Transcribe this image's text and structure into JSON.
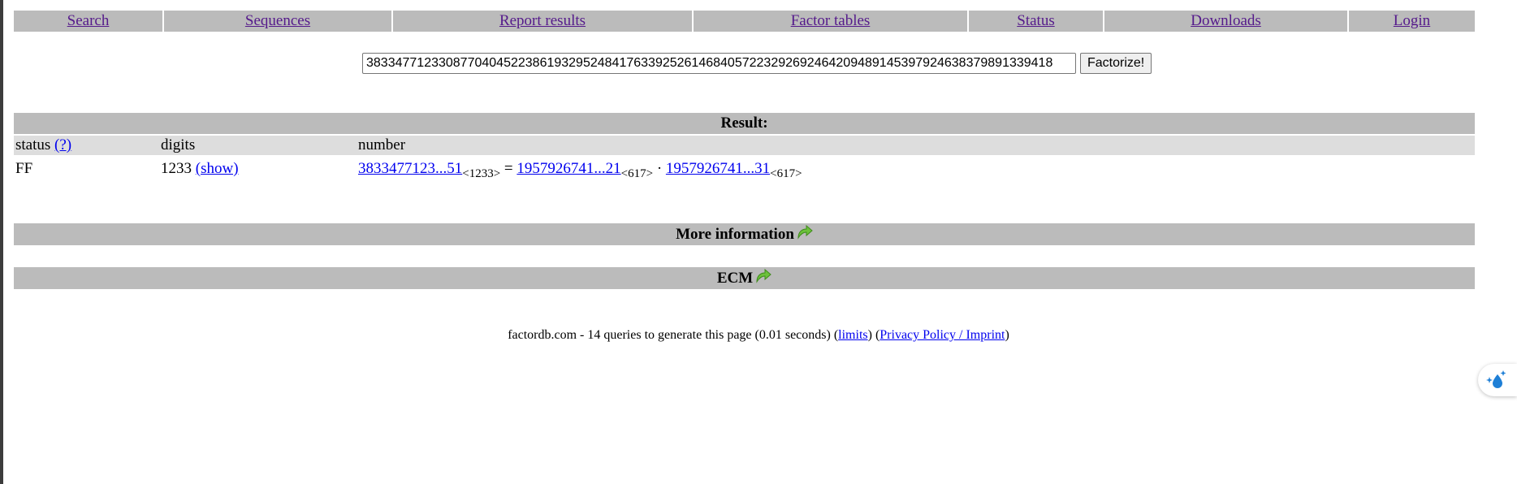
{
  "nav": {
    "items": [
      {
        "label": "Search"
      },
      {
        "label": "Sequences"
      },
      {
        "label": "Report results"
      },
      {
        "label": "Factor tables"
      },
      {
        "label": "Status"
      },
      {
        "label": "Downloads"
      },
      {
        "label": "Login"
      }
    ]
  },
  "search": {
    "value": "38334771233087704045223861932952484176339252614684057223292692464209489145397924638379891339418",
    "button_label": "Factorize!"
  },
  "result": {
    "title": "Result:",
    "headers": {
      "status": "status",
      "status_help": "(?)",
      "digits": "digits",
      "number": "number"
    },
    "row": {
      "status": "FF",
      "digits": "1233",
      "show_link": "(show)",
      "number_link": "3833477123...51",
      "number_digits": "<1233>",
      "equals": "=",
      "factor1_link": "1957926741...21",
      "factor1_digits": "<617>",
      "dot": "·",
      "factor2_link": "1957926741...31",
      "factor2_digits": "<617>"
    }
  },
  "sections": {
    "more_info": "More information",
    "ecm": "ECM"
  },
  "footer": {
    "text": "factordb.com - 14 queries to generate this page (0.01 seconds) (",
    "limits_link": "limits",
    "mid": ") (",
    "privacy_link": "Privacy Policy / Imprint",
    "end": ")"
  },
  "colors": {
    "bar_bg": "#bbbbbb",
    "header_bg": "#dddddd",
    "link": "#0000ee",
    "visited_link": "#551a8b",
    "arrow_green": "#6cc13a"
  }
}
